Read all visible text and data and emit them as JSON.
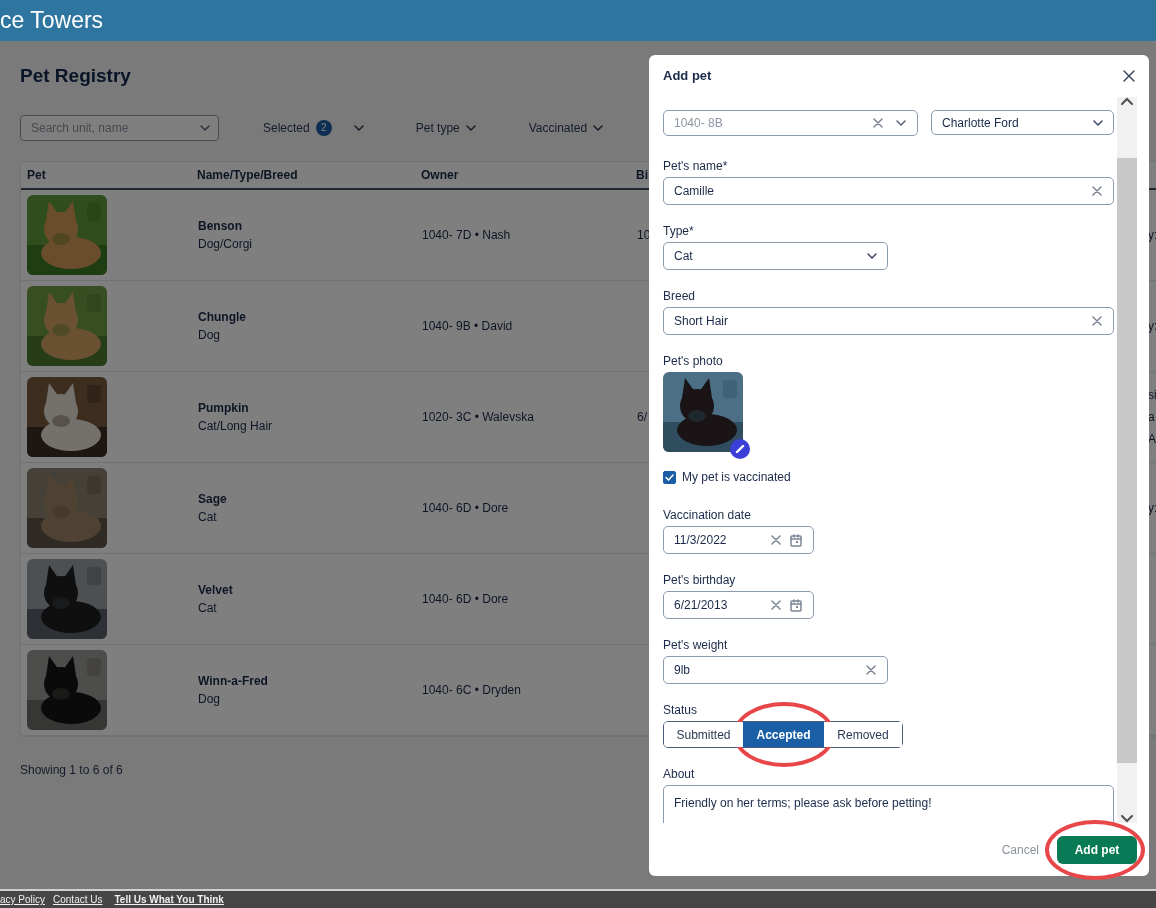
{
  "header": {
    "title": "ce Towers"
  },
  "page": {
    "title": "Pet Registry"
  },
  "filters": {
    "search": {
      "placeholder": "Search unit, name"
    },
    "selected": {
      "label": "Selected",
      "count": "2"
    },
    "dropdowns": [
      "Pet type",
      "Vaccinated"
    ]
  },
  "table": {
    "columns": [
      "Pet",
      "Name/Type/Breed",
      "Owner",
      "Bi"
    ],
    "rows": [
      {
        "photo": {
          "kind": "picture"
        },
        "name": "Benson",
        "type": "Dog/Corgi",
        "owner": "1040- 7D • Nash",
        "column_4": "10",
        "column_5": [
          "y:"
        ]
      },
      {
        "photo": {
          "kind": "picture"
        },
        "name": "Chungle",
        "type": "Dog",
        "owner": "1040- 9B • David",
        "column_5": [
          "y:"
        ]
      },
      {
        "photo": {
          "kind": "picture"
        },
        "name": "Pumpkin",
        "type": "Cat/Long Hair",
        "owner": "1020- 3C • Walevska",
        "column_4": "6/",
        "column_5": [
          "si",
          "a",
          "A"
        ]
      },
      {
        "photo": {
          "kind": "picture"
        },
        "name": "Sage",
        "type": "Cat",
        "owner": "1040- 6D • Dore",
        "column_5": [
          "y:"
        ]
      },
      {
        "photo": {
          "kind": "picture"
        },
        "name": "Velvet",
        "type": "Cat",
        "owner": "1040- 6D • Dore"
      },
      {
        "photo": {
          "kind": "picture"
        },
        "name": "Winn-a-Fred",
        "type": "Dog",
        "owner": "1040- 6C • Dryden"
      }
    ]
  },
  "showing": "Showing 1 to 6 of 6",
  "modal": {
    "title": "Add pet",
    "unit": {
      "value": "1040- 8B",
      "disabled": true
    },
    "owner": {
      "value": "Charlotte Ford"
    },
    "fields": [
      {
        "kind": "text",
        "label": "Pet's name*",
        "value": "Camille"
      },
      {
        "kind": "select",
        "label": "Type*",
        "value": "Cat"
      },
      {
        "kind": "text",
        "label": "Breed",
        "value": "Short Hair"
      },
      {
        "label": "Pet's photo",
        "photo": {
          "kind": "picture"
        }
      },
      {
        "kind": "checkbox",
        "label": "My pet is vaccinated",
        "checked": true
      },
      {
        "kind": "date",
        "label": "Vaccination date",
        "value": "11/3/2022"
      },
      {
        "kind": "date",
        "label": "Pet's birthday",
        "value": "6/21/2013"
      },
      {
        "kind": "short_text",
        "label": "Pet's weight",
        "value": "9lb"
      },
      {
        "kind": "segmented",
        "label": "Status",
        "options": [
          {
            "label": "Submitted",
            "selected": false,
            "circled": false
          },
          {
            "label": "Accepted",
            "selected": true,
            "circled": true
          },
          {
            "label": "Removed",
            "selected": false,
            "circled": false
          }
        ]
      },
      {
        "kind": "textarea",
        "label": "About",
        "value": "Friendly on her terms; please ask before petting!"
      }
    ],
    "cancel": "Cancel",
    "submit": {
      "label": "Add pet",
      "circled": true
    }
  },
  "footer": {
    "links": [
      {
        "label": "acy Policy",
        "emphasized": false
      },
      {
        "label": "Contact Us",
        "emphasized": false
      },
      {
        "label": "Tell Us What You Think",
        "emphasized": true
      }
    ]
  }
}
